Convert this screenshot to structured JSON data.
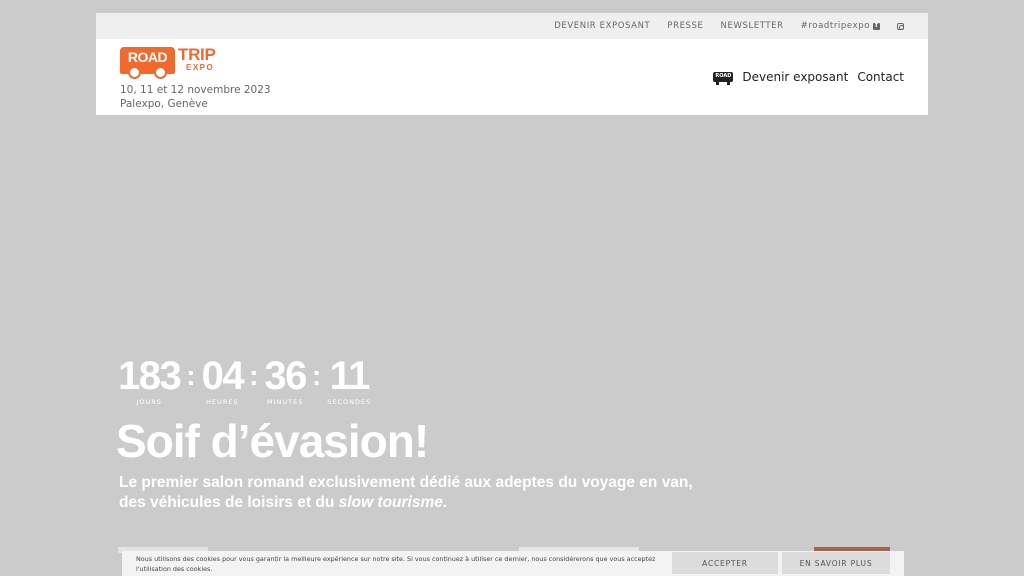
{
  "topbar": {
    "links": [
      "DEVENIR EXPOSANT",
      "PRESSE",
      "NEWSLETTER"
    ],
    "hashtag": "#roadtripexpo",
    "icons": [
      "facebook-icon",
      "instagram-icon"
    ]
  },
  "header": {
    "logo": {
      "road": "ROAD",
      "trip": "TRIP",
      "expo": "EXPO"
    },
    "dates": "10, 11 et 12 novembre 2023",
    "venue": "Palexpo, Genève",
    "nav": {
      "icon_text": "ROAD",
      "exhibitor": "Devenir exposant",
      "contact": "Contact"
    }
  },
  "countdown": {
    "days": "183",
    "hours": "04",
    "minutes": "36",
    "seconds": "11",
    "separator": ":",
    "labels": {
      "days": "JOURS",
      "hours": "HEURES",
      "minutes": "MINUTES",
      "seconds": "SECONDES"
    }
  },
  "hero": {
    "headline": "Soif d’évasion!",
    "subtitle_main": "Le premier salon romand exclusivement dédié aux adeptes du voyage en van, des véhicules de loisirs et du ",
    "subtitle_emphasis": "slow tourisme",
    "subtitle_end": "."
  },
  "cookie": {
    "text": "Nous utilisons des cookies pour vous garantir la meilleure expérience sur notre site. Si vous continuez à utiliser ce dernier, nous considérerons que vous acceptez l'utilisation des cookies.",
    "accept": "ACCEPTER",
    "more": "EN SAVOIR PLUS"
  },
  "colors": {
    "background": "#cbcbcb",
    "brand_orange": "#ef6a2c",
    "topbar": "#efefef"
  }
}
